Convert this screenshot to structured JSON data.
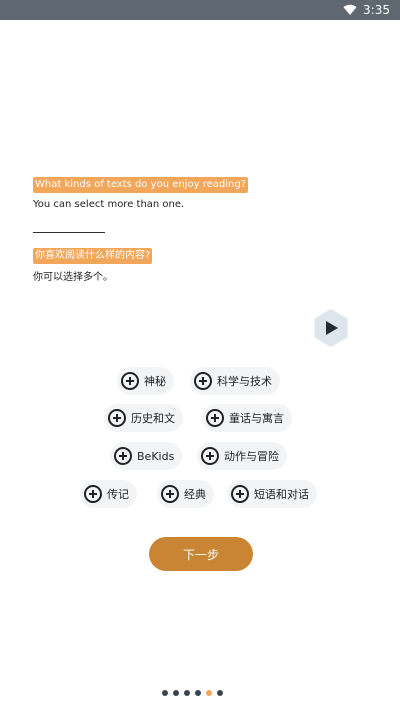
{
  "status_bar": {
    "time": "3:35",
    "wifi_icon": "wifi-icon"
  },
  "question": {
    "en": "What kinds of texts do you enjoy reading?",
    "en_hint": "You can select more than one.",
    "zh": "你喜欢阅读什么样的内容?",
    "zh_hint": "你可以选择多个。"
  },
  "play_button": {
    "icon": "play-icon"
  },
  "chips": [
    {
      "label": "神秘"
    },
    {
      "label": "科学与技术"
    },
    {
      "label": "历史和文"
    },
    {
      "label": "童话与寓言"
    },
    {
      "label": "BeKids"
    },
    {
      "label": "动作与冒险"
    },
    {
      "label": "传记"
    },
    {
      "label": "经典"
    },
    {
      "label": "短语和对话"
    }
  ],
  "next_button": {
    "label": "下一步"
  },
  "pagination": {
    "count": 6,
    "active_index": 4
  },
  "colors": {
    "accent": "#f2a65a",
    "button": "#c98534",
    "status_bar": "#5f6770"
  }
}
